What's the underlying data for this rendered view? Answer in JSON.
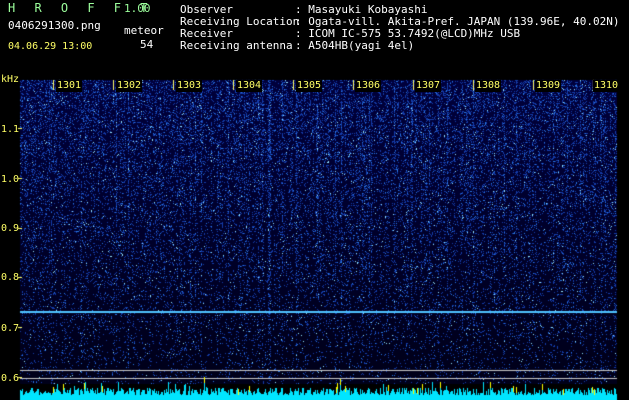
{
  "header": {
    "app_name": "H R O F F T",
    "version": "1.00",
    "filename": "0406291300.png",
    "datetime": "04.06.29 13:00",
    "counter_label": "meteor",
    "counter_value": "54"
  },
  "info": [
    {
      "label": "Observer",
      "value": ": Masayuki Kobayashi"
    },
    {
      "label": "Receiving Location",
      "value": ": Ogata-vill. Akita-Pref. JAPAN (139.96E, 40.02N)"
    },
    {
      "label": "Receiver",
      "value": ": ICOM IC-575 53.7492(@LCD)MHz USB"
    },
    {
      "label": "Receiving antenna",
      "value": ": A504HB(yagi 4el)"
    }
  ],
  "axis": {
    "unit": "kHz",
    "y_ticks": [
      "1.1",
      "1.0",
      "0.9",
      "0.8",
      "0.7",
      "0.6"
    ],
    "minute_labels": [
      "1301",
      "1302",
      "1303",
      "1304",
      "1305",
      "1306",
      "1307",
      "1308",
      "1309",
      "1310"
    ]
  },
  "colors": {
    "text_yellow": "#ffff66",
    "logo_green": "#9cff9c",
    "signal_cyan": "#00e5ff",
    "background": "#000000"
  }
}
